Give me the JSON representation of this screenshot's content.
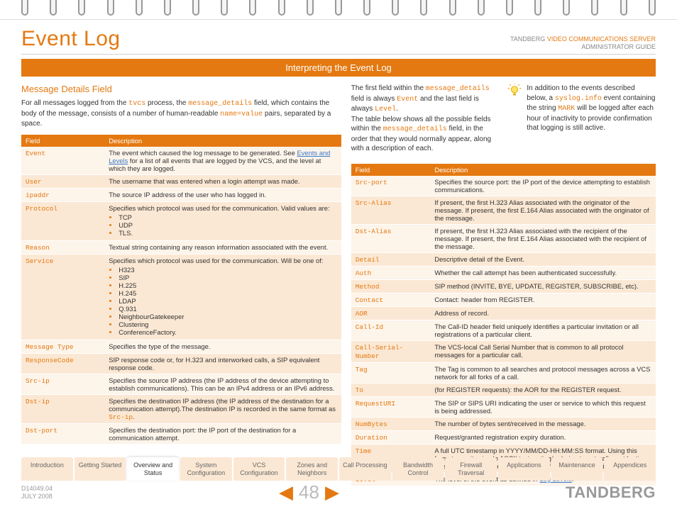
{
  "header": {
    "title": "Event Log",
    "brand_upper": "TANDBERG",
    "brand_product": "VIDEO COMMUNICATIONS SERVER",
    "brand_line2": "ADMINISTRATOR GUIDE"
  },
  "banner": "Interpreting the Event Log",
  "section_heading": "Message Details Field",
  "intro_left_1": "For all messages logged from the ",
  "intro_left_tvcs": "tvcs",
  "intro_left_2": " process, the ",
  "intro_left_md": "message_details",
  "intro_left_3": " field, which contains the body of the message, consists of a number of human-readable ",
  "intro_left_nv": "name=value",
  "intro_left_4": " pairs, separated by a space.",
  "intro_mid_a1": "The first field within the ",
  "intro_mid_md": "message_details",
  "intro_mid_a2": " field is always ",
  "intro_mid_event": "Event",
  "intro_mid_a3": " and the last field is always ",
  "intro_mid_level": "Level",
  "intro_mid_a4": ".",
  "intro_mid_b1": "The table below shows all the possible fields within the ",
  "intro_mid_b2": " field, in the order that they would normally appear, along with a description of each.",
  "intro_right_1": "In addition to the events described below, a ",
  "intro_right_syslog": "syslog.info",
  "intro_right_2": " event containing the string ",
  "intro_right_mark": "MARK",
  "intro_right_3": " will be logged after each hour of inactivity to provide confirmation that logging is still active.",
  "cols": {
    "field": "Field",
    "desc": "Description"
  },
  "table1": [
    {
      "f": "Event",
      "d": "The event which caused the log message to be generated. See ",
      "link": "Events and Levels",
      "d2": " for a list of all events that are logged by the VCS, and the level at which they are logged."
    },
    {
      "f": "User",
      "d": "The username that was entered when a login attempt was made."
    },
    {
      "f": "ipaddr",
      "d": "The source IP address of the user who has logged in."
    },
    {
      "f": "Protocol",
      "d": "Specifies which protocol was used for the communication. Valid values are:",
      "list": [
        "TCP",
        "UDP",
        "TLS."
      ]
    },
    {
      "f": "Reason",
      "d": "Textual string containing any reason information associated with the event."
    },
    {
      "f": "Service",
      "d": "Specifies which protocol was used for the communication. Will be one of:",
      "list": [
        "H323",
        "SIP",
        "H.225",
        "H.245",
        "LDAP",
        "Q.931",
        "NeighbourGatekeeper",
        "Clustering",
        "ConferenceFactory."
      ]
    },
    {
      "f": "Message Type",
      "d": "Specifies the type of the message."
    },
    {
      "f": "ResponseCode",
      "d": "SIP response code or, for H.323 and interworked calls, a SIP equivalent response code."
    },
    {
      "f": "Src-ip",
      "d": "Specifies the source IP address (the IP address of the device attempting to establish communications). This can be an IPv4 address or an IPv6 address."
    },
    {
      "f": "Dst-ip",
      "d": "Specifies the destination IP address (the IP address of the destination for a communication attempt).",
      "d2": "The destination IP is recorded in the same format as ",
      "mono": "Src-ip",
      "d3": "."
    },
    {
      "f": "Dst-port",
      "d": "Specifies the destination port: the IP port of the destination for a communication attempt."
    }
  ],
  "table2": [
    {
      "f": "Src-port",
      "d": "Specifies the source port: the IP port of the device attempting to establish communications."
    },
    {
      "f": "Src-Alias",
      "d": "If present, the first H.323 Alias associated with the originator of the message. If present, the first E.164 Alias associated with the originator of the message."
    },
    {
      "f": "Dst-Alias",
      "d": "If present, the first H.323 Alias associated with the recipient of the message. If present, the first E.164 Alias associated with the recipient of the message."
    },
    {
      "f": "Detail",
      "d": "Descriptive detail of the Event."
    },
    {
      "f": "Auth",
      "d": "Whether the call attempt has been authenticated successfully."
    },
    {
      "f": "Method",
      "d": "SIP method (INVITE, BYE, UPDATE, REGISTER, SUBSCRIBE, etc)."
    },
    {
      "f": "Contact",
      "d": "Contact: header from REGISTER."
    },
    {
      "f": "AOR",
      "d": "Address of record."
    },
    {
      "f": "Call-Id",
      "d": "The Call-ID header field uniquely identifies a particular invitation or all registrations of a particular client."
    },
    {
      "f": "Call-Serial-Number",
      "d": "The VCS-local Call Serial Number that is common to all protocol messages for a particular call."
    },
    {
      "f": "Tag",
      "d": "The Tag is common to all searches and protocol messages across a VCS network for all forks of a call."
    },
    {
      "f": "To",
      "d": "(for REGISTER requests): the AOR for the REGISTER request."
    },
    {
      "f": "RequestURI",
      "d": "The SIP or SIPS URI indicating the user or service to which this request is being addressed."
    },
    {
      "f": "NumBytes",
      "d": "The number of bytes sent/received in the message."
    },
    {
      "f": "Duration",
      "d": "Request/granted registration expiry duration."
    },
    {
      "f": "Time",
      "d": "A full UTC timestamp in YYYY/MM/DD-HH:MM:SS format. Using this format permits simple ASCII text sorting/ordering to naturally sort by time. This is included due to the limitations of standard syslog timestamps."
    },
    {
      "f": "Level",
      "d": "The level of the event as defined in ",
      "link": "Log Levels",
      "d2": "."
    }
  ],
  "tabs": [
    "Introduction",
    "Getting Started",
    "Overview and Status",
    "System Configuration",
    "VCS Configuration",
    "Zones and Neighbors",
    "Call Processing",
    "Bandwidth Control",
    "Firewall Traversal",
    "Applications",
    "Maintenance",
    "Appendices"
  ],
  "active_tab": 2,
  "footer": {
    "doc_id": "D14049.04",
    "doc_date": "JULY 2008",
    "page": "48",
    "logo": "TANDBERG"
  }
}
